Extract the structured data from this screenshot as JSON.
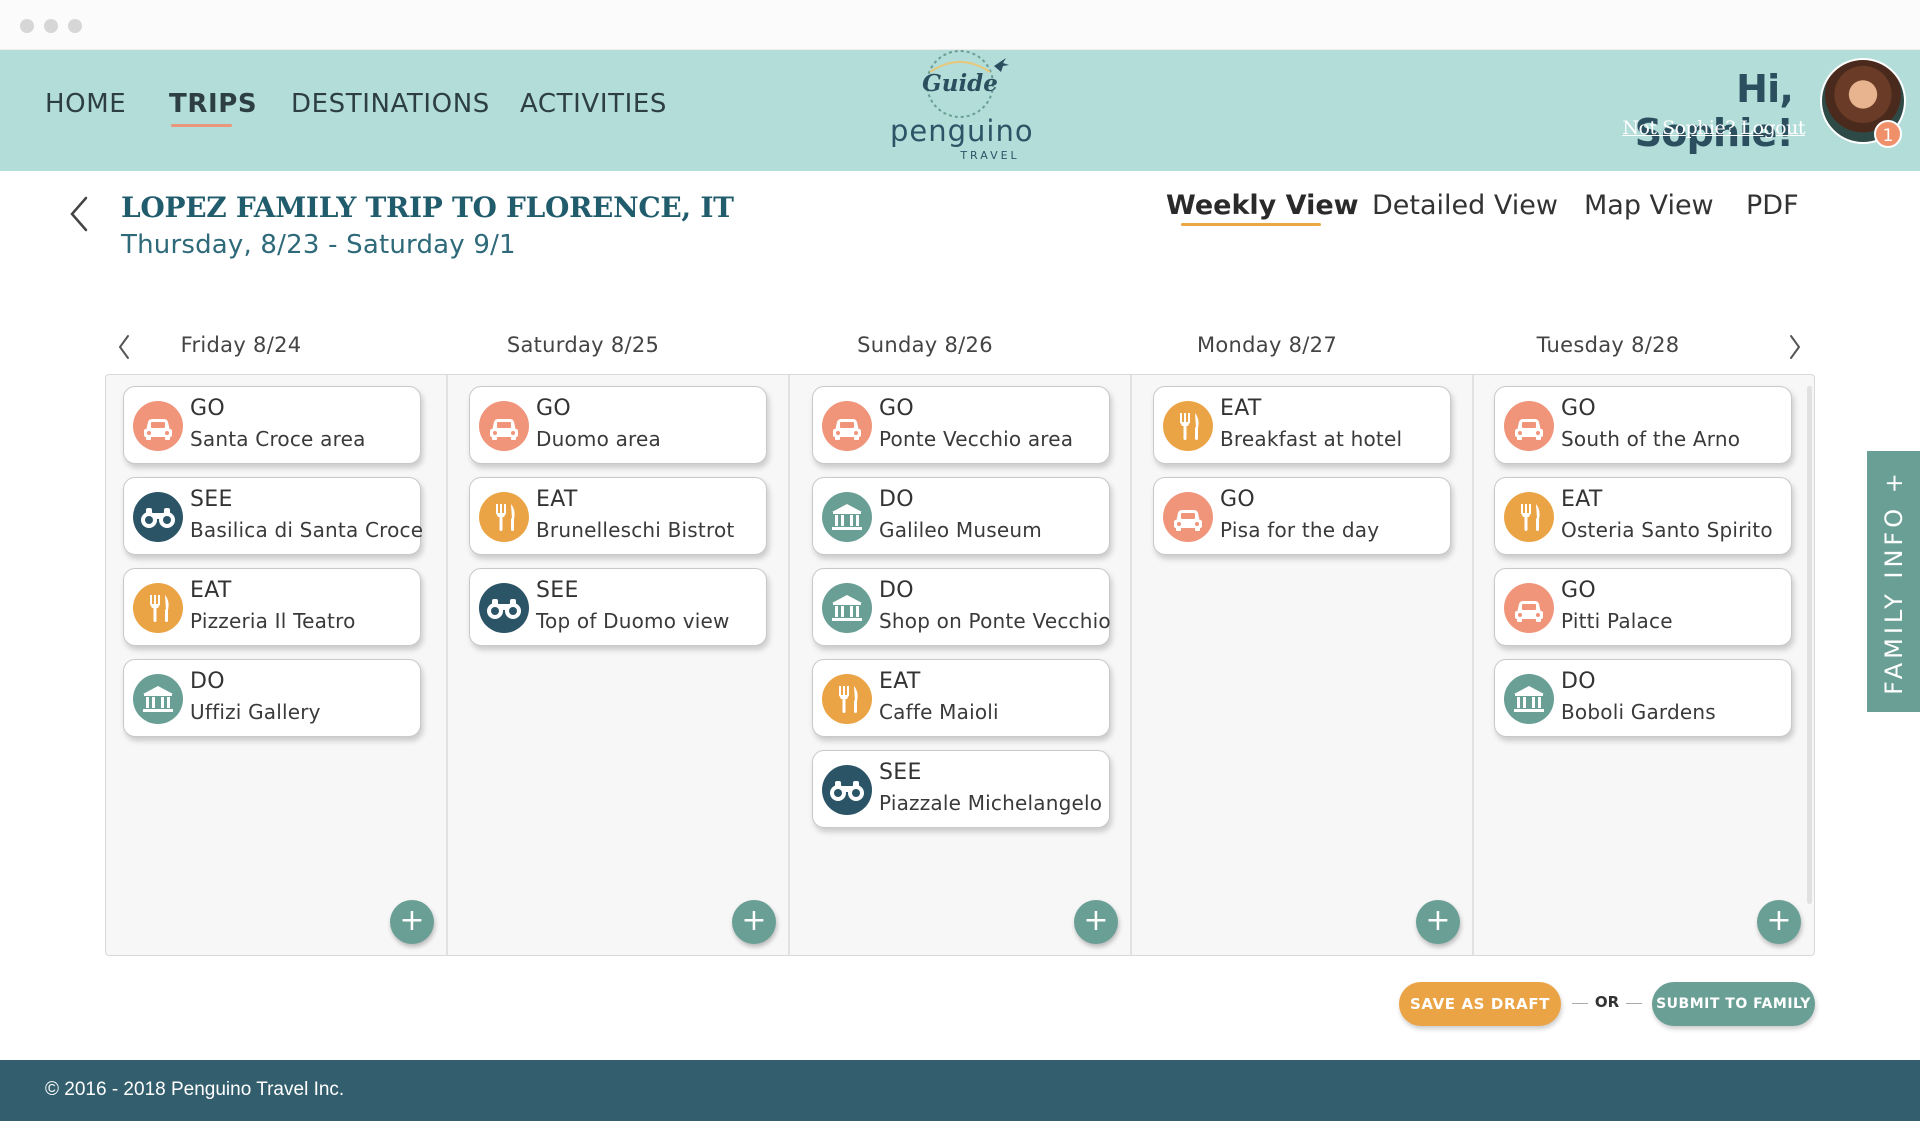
{
  "nav": {
    "items": [
      {
        "label": "HOME",
        "active": false
      },
      {
        "label": "TRIPS",
        "active": true
      },
      {
        "label": "DESTINATIONS",
        "active": false
      },
      {
        "label": "ACTIVITIES",
        "active": false
      }
    ]
  },
  "logo": {
    "script": "Guide",
    "name": "penguino",
    "sub": "TRAVEL"
  },
  "user": {
    "greeting": "Hi, Sophie!",
    "logout": "Not Sophie? Logout",
    "notifications": "1"
  },
  "trip": {
    "title": "LOPEZ FAMILY TRIP TO FLORENCE, IT",
    "dates": "Thursday, 8/23 - Saturday 9/1"
  },
  "views": [
    {
      "label": "Weekly View",
      "active": true
    },
    {
      "label": "Detailed View",
      "active": false
    },
    {
      "label": "Map View",
      "active": false
    },
    {
      "label": "PDF",
      "active": false
    }
  ],
  "days": [
    {
      "label": "Friday 8/24",
      "items": [
        {
          "type": "GO",
          "name": "Santa Croce area",
          "icon": "car-icon"
        },
        {
          "type": "SEE",
          "name": "Basilica di Santa Croce",
          "icon": "binoculars-icon"
        },
        {
          "type": "EAT",
          "name": "Pizzeria Il Teatro",
          "icon": "fork-knife-icon"
        },
        {
          "type": "DO",
          "name": "Uffizi Gallery",
          "icon": "museum-icon"
        }
      ]
    },
    {
      "label": "Saturday 8/25",
      "items": [
        {
          "type": "GO",
          "name": "Duomo area",
          "icon": "car-icon"
        },
        {
          "type": "EAT",
          "name": "Brunelleschi Bistrot",
          "icon": "fork-knife-icon"
        },
        {
          "type": "SEE",
          "name": "Top of Duomo view",
          "icon": "binoculars-icon"
        }
      ]
    },
    {
      "label": "Sunday 8/26",
      "items": [
        {
          "type": "GO",
          "name": "Ponte Vecchio area",
          "icon": "car-icon"
        },
        {
          "type": "DO",
          "name": "Galileo Museum",
          "icon": "museum-icon"
        },
        {
          "type": "DO",
          "name": "Shop on Ponte Vecchio",
          "icon": "museum-icon"
        },
        {
          "type": "EAT",
          "name": "Caffe Maioli",
          "icon": "fork-knife-icon"
        },
        {
          "type": "SEE",
          "name": "Piazzale Michelangelo",
          "icon": "binoculars-icon"
        }
      ]
    },
    {
      "label": "Monday 8/27",
      "items": [
        {
          "type": "EAT",
          "name": "Breakfast at hotel",
          "icon": "fork-knife-icon"
        },
        {
          "type": "GO",
          "name": "Pisa for the day",
          "icon": "car-icon"
        }
      ]
    },
    {
      "label": "Tuesday 8/28",
      "items": [
        {
          "type": "GO",
          "name": "South of the Arno",
          "icon": "car-icon"
        },
        {
          "type": "EAT",
          "name": "Osteria Santo Spirito",
          "icon": "fork-knife-icon"
        },
        {
          "type": "GO",
          "name": "Pitti Palace",
          "icon": "car-icon"
        },
        {
          "type": "DO",
          "name": "Boboli Gardens",
          "icon": "museum-icon"
        }
      ]
    }
  ],
  "add_label": "+",
  "side_tab": {
    "label": "FAMILY INFO",
    "plus": "+"
  },
  "actions": {
    "draft": "SAVE AS DRAFT",
    "or": "OR",
    "submit": "SUBMIT TO FAMILY"
  },
  "footer": {
    "copyright": "© 2016 - 2018 Penguino Travel Inc."
  },
  "colors": {
    "header_bg": "#b3ddd9",
    "go": "#f0947a",
    "see": "#2b5566",
    "eat": "#eba445",
    "do": "#6a9f95",
    "footer_bg": "#335e6d"
  }
}
